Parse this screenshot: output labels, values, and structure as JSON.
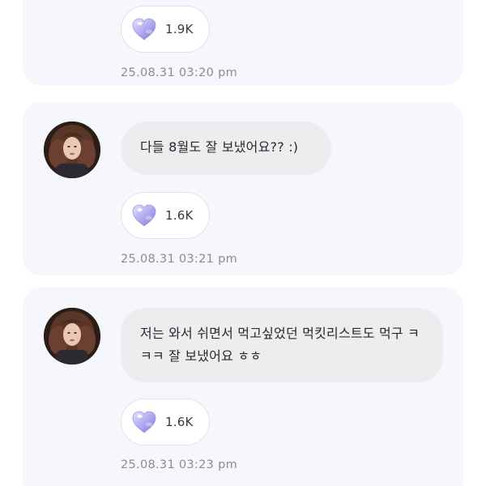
{
  "messages": [
    {
      "likes": "1.9K",
      "timestamp": "25.08.31 03:20 pm"
    },
    {
      "text": "다들 8월도 잘 보냈어요?? :)",
      "likes": "1.6K",
      "timestamp": "25.08.31 03:21 pm"
    },
    {
      "text": "저는 와서 쉬면서 먹고싶었던 먹킷리스트도 먹구 ㅋㅋㅋ 잘 보냈어요 ㅎㅎ",
      "likes": "1.6K",
      "timestamp": "25.08.31 03:23 pm"
    }
  ],
  "icons": {
    "avatar": "profile-photo",
    "like": "heart-icon"
  },
  "colors": {
    "card_bg": "#f6f7fc",
    "bubble_bg": "#ededf0",
    "heart": "#b7b2f0",
    "timestamp": "#8c8c92"
  }
}
